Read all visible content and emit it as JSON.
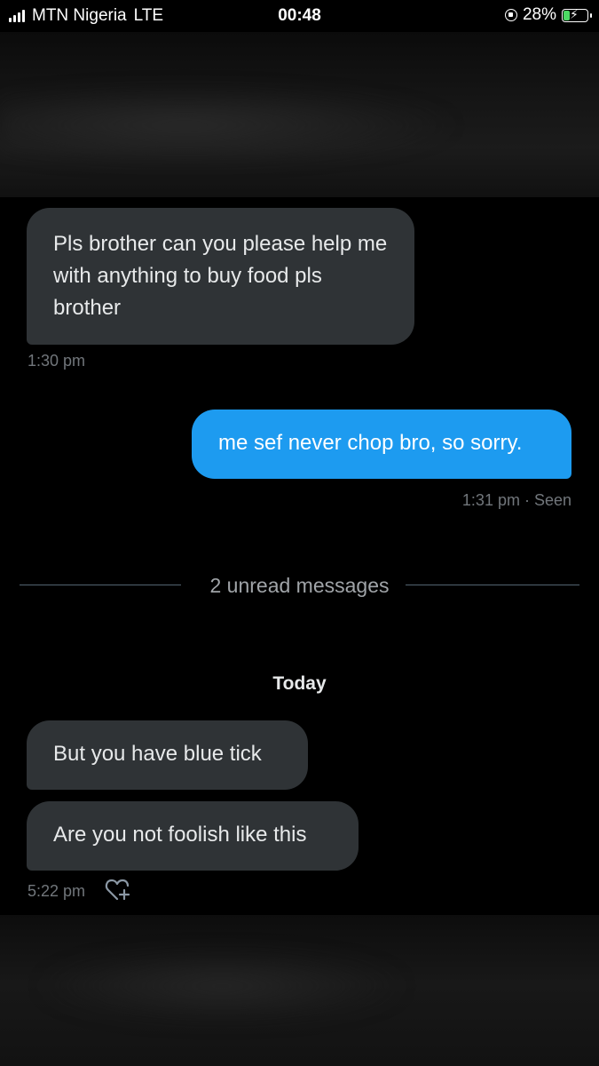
{
  "status_bar": {
    "carrier": "MTN Nigeria",
    "network": "LTE",
    "time": "00:48",
    "battery": "28%",
    "battery_level": 0.28
  },
  "messages": [
    {
      "direction": "incoming",
      "text": "Pls brother can you please help me with anything to buy food pls brother"
    },
    {
      "direction": "outgoing",
      "text": "me sef never chop bro, so sorry."
    },
    {
      "direction": "incoming",
      "text": "But you have blue tick"
    },
    {
      "direction": "incoming",
      "text": "Are you not foolish like this"
    }
  ],
  "timestamps": {
    "first": "1:30 pm",
    "second": "1:31 pm · Seen",
    "last": "5:22 pm"
  },
  "divider_text": "2 unread messages",
  "day_label": "Today",
  "icons": [
    "signal-icon",
    "orientation-lock-icon",
    "battery-icon",
    "add-reaction-icon"
  ],
  "colors": {
    "incoming_bubble": "#2f3336",
    "outgoing_bubble": "#1d9bf0",
    "meta_text": "#71767b"
  }
}
